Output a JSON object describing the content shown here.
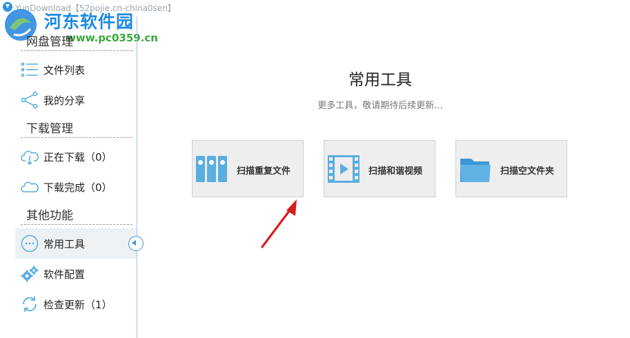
{
  "titlebar": {
    "title": "YunDownload【52pojie.cn-china0sen】"
  },
  "watermark": {
    "site_name": "河东软件园",
    "url": "www.pc0359.cn"
  },
  "sidebar": {
    "sections": [
      {
        "header": "网盘管理",
        "items": [
          {
            "label": "文件列表",
            "icon": "list-icon"
          },
          {
            "label": "我的分享",
            "icon": "share-icon"
          }
        ]
      },
      {
        "header": "下载管理",
        "items": [
          {
            "label": "正在下载（0）",
            "icon": "cloud-download-icon"
          },
          {
            "label": "下载完成（0）",
            "icon": "cloud-done-icon"
          }
        ]
      },
      {
        "header": "其他功能",
        "items": [
          {
            "label": "常用工具",
            "icon": "more-dots-icon",
            "active": true
          },
          {
            "label": "软件配置",
            "icon": "gears-icon"
          },
          {
            "label": "检查更新（1）",
            "icon": "refresh-icon"
          }
        ]
      }
    ]
  },
  "main": {
    "title": "常用工具",
    "subtitle": "更多工具，敬请期待后续更新...",
    "tools": [
      {
        "label": "扫描重复文件",
        "icon": "binders-icon"
      },
      {
        "label": "扫描和谐视频",
        "icon": "film-icon"
      },
      {
        "label": "扫描空文件夹",
        "icon": "folder-icon"
      }
    ]
  },
  "colors": {
    "accent": "#3b97d8",
    "icon_blue": "#5aaee0",
    "sidebar_active": "#eef1f3",
    "card_bg": "#eeeeee",
    "annotation_arrow": "#d81e1e"
  }
}
